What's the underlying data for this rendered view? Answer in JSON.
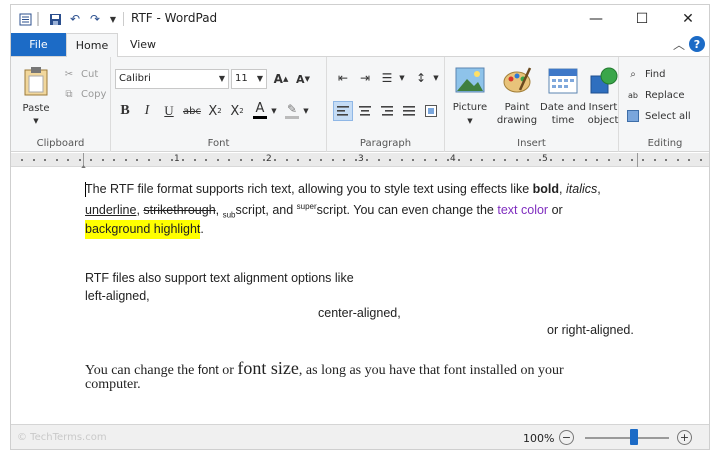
{
  "window": {
    "title": "RTF - WordPad"
  },
  "quick_access": {
    "customize_icon": "dropdown-arrow-icon"
  },
  "window_controls": {
    "minimize": "—",
    "maximize": "☐",
    "close": "✕"
  },
  "tabs": {
    "file": "File",
    "home": "Home",
    "view": "View"
  },
  "ribbon": {
    "clipboard": {
      "label": "Clipboard",
      "paste": "Paste",
      "cut": "Cut",
      "copy": "Copy"
    },
    "font": {
      "label": "Font",
      "family": "Calibri",
      "size": "11"
    },
    "paragraph": {
      "label": "Paragraph"
    },
    "insert": {
      "label": "Insert",
      "picture": "Picture",
      "paint_1": "Paint",
      "paint_2": "drawing",
      "date_1": "Date and",
      "date_2": "time",
      "object_1": "Insert",
      "object_2": "object"
    },
    "editing": {
      "label": "Editing",
      "find": "Find",
      "replace": "Replace",
      "select_all": "Select all"
    }
  },
  "ruler": {
    "numbers": [
      "1",
      "2",
      "3",
      "4",
      "5"
    ]
  },
  "document": {
    "p1": {
      "a": "The RTF file format supports rich text, allowing you to style text using effects like ",
      "bold": "bold",
      "b": ", ",
      "italics": "italics",
      "c": ",",
      "underline": "underline",
      "d": ", ",
      "strike": "strikethrough",
      "e": ", ",
      "sub": "sub",
      "f": "script, and ",
      "sup": "super",
      "g": "script. You can even change the ",
      "color_text": "text color",
      "h": " or",
      "highlight": "background highlight",
      "i": "."
    },
    "p2": {
      "line1": "RTF files also support text alignment options like",
      "left": "left-aligned,",
      "center": "center-aligned,",
      "right": "or right-aligned."
    },
    "p3": {
      "a": "You can change the ",
      "font": "font",
      "b": " or ",
      "size": "font size",
      "c": ", as long as you have that font installed on your",
      "line2": "computer."
    }
  },
  "status": {
    "watermark": "© TechTerms.com",
    "zoom": "100%",
    "zoom_out": "−",
    "zoom_in": "+",
    "zoom_fraction": 0.58
  },
  "colors": {
    "accent": "#1c6bc6",
    "highlight": "#ffff00",
    "text_color": "#7f2dbf"
  }
}
